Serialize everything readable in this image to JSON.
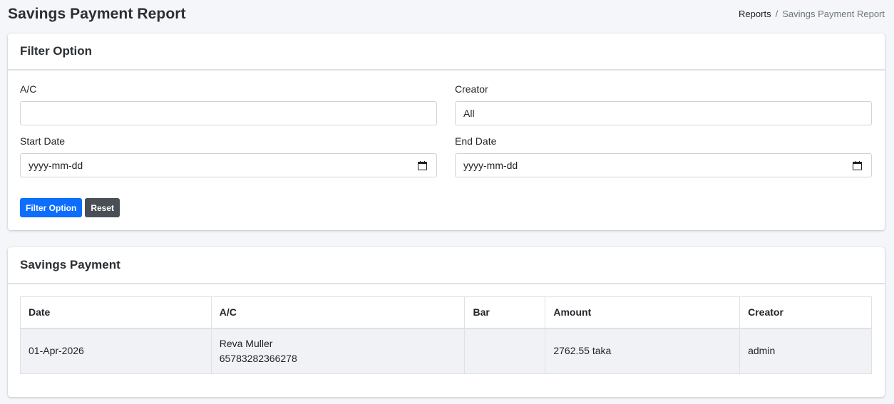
{
  "page": {
    "title": "Savings Payment Report",
    "breadcrumb": {
      "parent": "Reports",
      "separator": "/",
      "current": "Savings Payment Report"
    }
  },
  "filter": {
    "title": "Filter Option",
    "ac_label": "A/C",
    "ac_value": "",
    "creator_label": "Creator",
    "creator_value": "All",
    "start_label": "Start Date",
    "start_placeholder": "yyyy-mm-dd",
    "end_label": "End Date",
    "end_placeholder": "yyyy-mm-dd",
    "filter_button": "Filter Option",
    "reset_button": "Reset"
  },
  "table": {
    "title": "Savings Payment",
    "headers": [
      "Date",
      "A/C",
      "Bar",
      "Amount",
      "Creator"
    ],
    "rows": [
      {
        "date": "01-Apr-2026",
        "ac_name": "Reva Muller",
        "ac_number": "65783282366278",
        "bar": "",
        "amount": "2762.55 taka",
        "creator": "admin"
      }
    ]
  },
  "colors": {
    "primary": "#0d6efd",
    "secondary": "#4a4f55",
    "background": "#f4f6f9"
  },
  "icons": [
    "calendar-icon"
  ]
}
